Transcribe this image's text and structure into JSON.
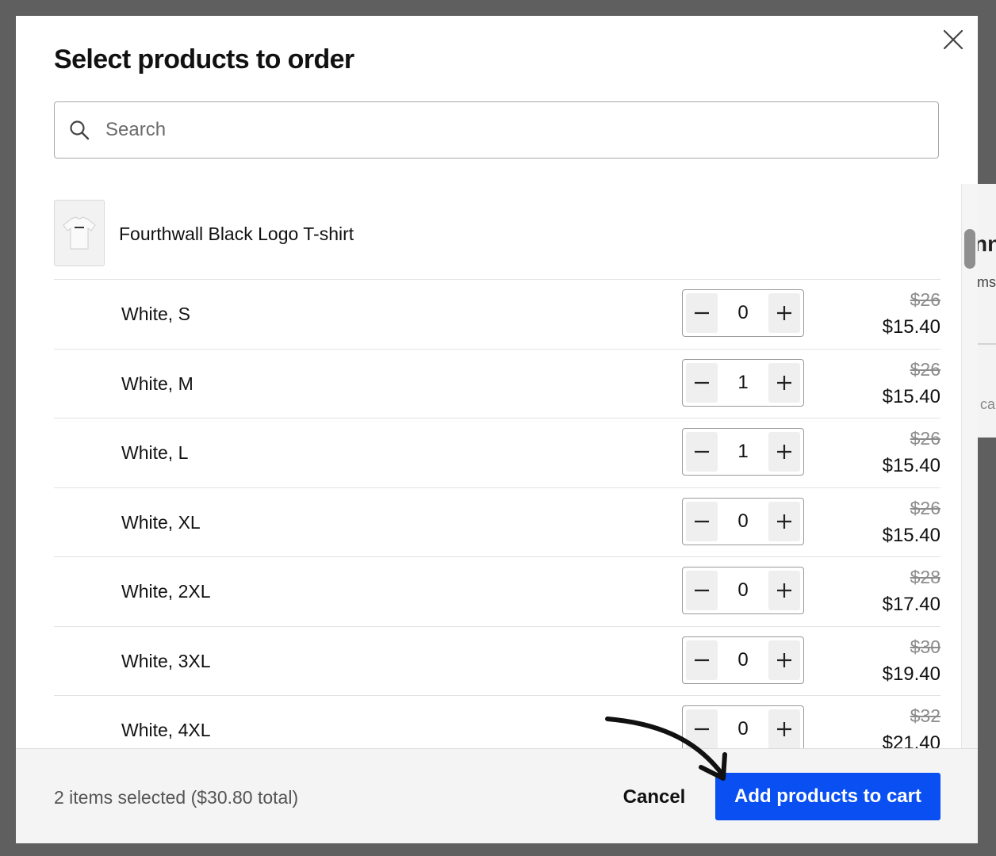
{
  "modal": {
    "title": "Select products to order"
  },
  "search": {
    "placeholder": "Search",
    "value": ""
  },
  "product": {
    "name": "Fourthwall Black Logo T-shirt",
    "thumbnail_icon": "tshirt-thumbnail"
  },
  "variants": [
    {
      "name": "White, S",
      "qty": "0",
      "old_price": "$26",
      "price": "$15.40"
    },
    {
      "name": "White, M",
      "qty": "1",
      "old_price": "$26",
      "price": "$15.40"
    },
    {
      "name": "White, L",
      "qty": "1",
      "old_price": "$26",
      "price": "$15.40"
    },
    {
      "name": "White, XL",
      "qty": "0",
      "old_price": "$26",
      "price": "$15.40"
    },
    {
      "name": "White, 2XL",
      "qty": "0",
      "old_price": "$28",
      "price": "$17.40"
    },
    {
      "name": "White, 3XL",
      "qty": "0",
      "old_price": "$30",
      "price": "$19.40"
    },
    {
      "name": "White, 4XL",
      "qty": "0",
      "old_price": "$32",
      "price": "$21.40"
    }
  ],
  "stepper_icons": {
    "decrement": "minus-icon",
    "increment": "plus-icon"
  },
  "footer": {
    "summary": "2 items selected ($30.80 total)",
    "cancel_label": "Cancel",
    "add_label": "Add products to cart"
  },
  "background": {
    "peek_texts": [
      "nn",
      "ms",
      "ca"
    ]
  },
  "colors": {
    "primary_button": "#0a4ff2",
    "overlay": "#5f5f5f",
    "footer_bg": "#f4f4f4"
  }
}
